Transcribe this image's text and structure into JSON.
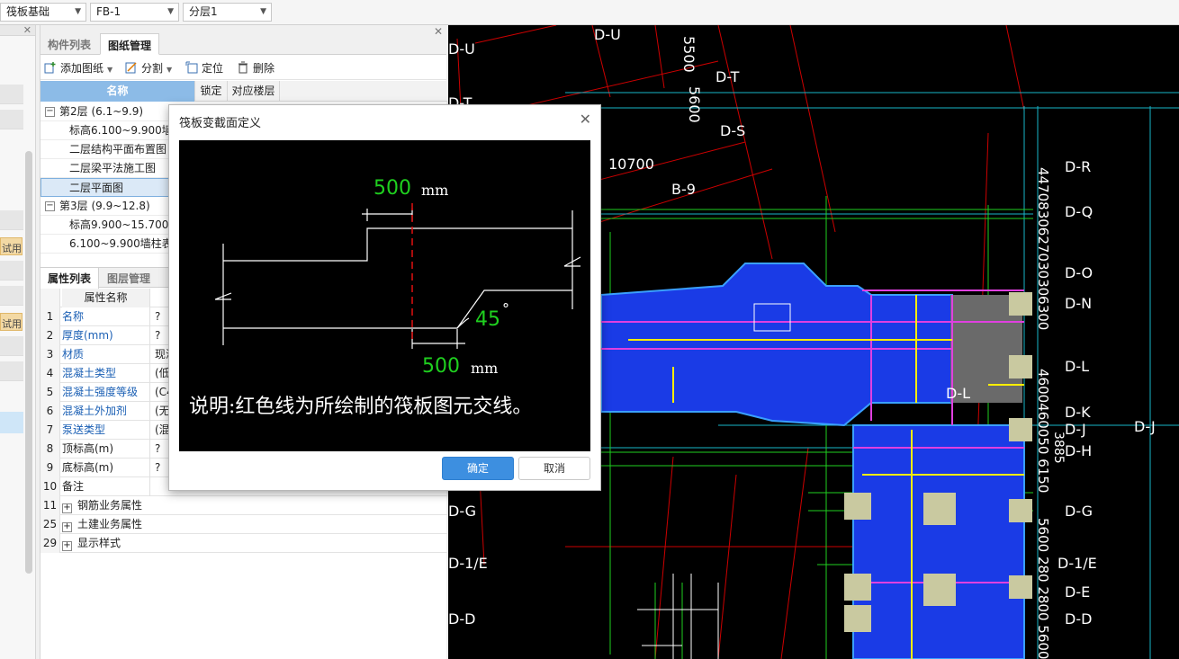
{
  "toolbar": {
    "category": "筏板基础",
    "component": "FB-1",
    "layer": "分层1"
  },
  "left_strip": {
    "tags": [
      "试用",
      "试用"
    ]
  },
  "top_tabs": [
    "构件列表",
    "图纸管理"
  ],
  "drawing_tools": {
    "add": "添加图纸",
    "split": "分割",
    "locate": "定位",
    "delete": "删除"
  },
  "drawing_table": {
    "headers": [
      "名称",
      "锁定",
      "对应楼层"
    ],
    "rows": [
      {
        "label": "第2层 (6.1~9.9)",
        "group": true
      },
      {
        "label": "标高6.100~9.900墙柱"
      },
      {
        "label": "二层结构平面布置图"
      },
      {
        "label": "二层梁平法施工图"
      },
      {
        "label": "二层平面图",
        "selected": true
      },
      {
        "label": "第3层 (9.9~12.8)",
        "group": true
      },
      {
        "label": "标高9.900~15.700墙"
      },
      {
        "label": "6.100~9.900墙柱表"
      }
    ]
  },
  "prop_tabs": [
    "属性列表",
    "图层管理"
  ],
  "prop_table": {
    "header": "属性名称",
    "rows": [
      {
        "num": "1",
        "name": "名称",
        "value": "?",
        "blue": true
      },
      {
        "num": "2",
        "name": "厚度(mm)",
        "value": "?",
        "blue": true
      },
      {
        "num": "3",
        "name": "材质",
        "value": "现浇",
        "blue": true
      },
      {
        "num": "4",
        "name": "混凝土类型",
        "value": "(低",
        "blue": true
      },
      {
        "num": "5",
        "name": "混凝土强度等级",
        "value": "(C4",
        "blue": true
      },
      {
        "num": "6",
        "name": "混凝土外加剂",
        "value": "(无",
        "blue": true
      },
      {
        "num": "7",
        "name": "泵送类型",
        "value": "(混",
        "blue": true
      },
      {
        "num": "8",
        "name": "顶标高(m)",
        "value": "?",
        "blue": false
      },
      {
        "num": "9",
        "name": "底标高(m)",
        "value": "?",
        "blue": false
      },
      {
        "num": "10",
        "name": "备注",
        "value": "",
        "blue": false
      },
      {
        "num": "11",
        "name": "钢筋业务属性",
        "value": "",
        "expand": true
      },
      {
        "num": "25",
        "name": "土建业务属性",
        "value": "",
        "expand": true
      },
      {
        "num": "29",
        "name": "显示样式",
        "value": "",
        "expand": true
      }
    ]
  },
  "dialog": {
    "title": "筏板变截面定义",
    "top_value": "500",
    "top_unit": "mm",
    "bottom_value": "500",
    "bottom_unit": "mm",
    "angle": "45",
    "angle_unit": "°",
    "note": "说明:红色线为所绘制的筏板图元交线。",
    "ok": "确定",
    "cancel": "取消"
  },
  "cad": {
    "axis_labels": [
      "D-U",
      "D-U",
      "D-T",
      "D-T",
      "D-S",
      "D-R",
      "D-Q",
      "D-O",
      "D-N",
      "D-L",
      "D-L",
      "D-K",
      "D-J",
      "D-J",
      "D-H",
      "D-G",
      "D-G",
      "D-1/E",
      "D-1/E",
      "D-E",
      "D-D",
      "D-D",
      "B-9"
    ],
    "dims": [
      "5500",
      "5600",
      "10700",
      "4470830627030306300",
      "4600460050 6150",
      "5600 280 2800 5600",
      "3885"
    ]
  }
}
